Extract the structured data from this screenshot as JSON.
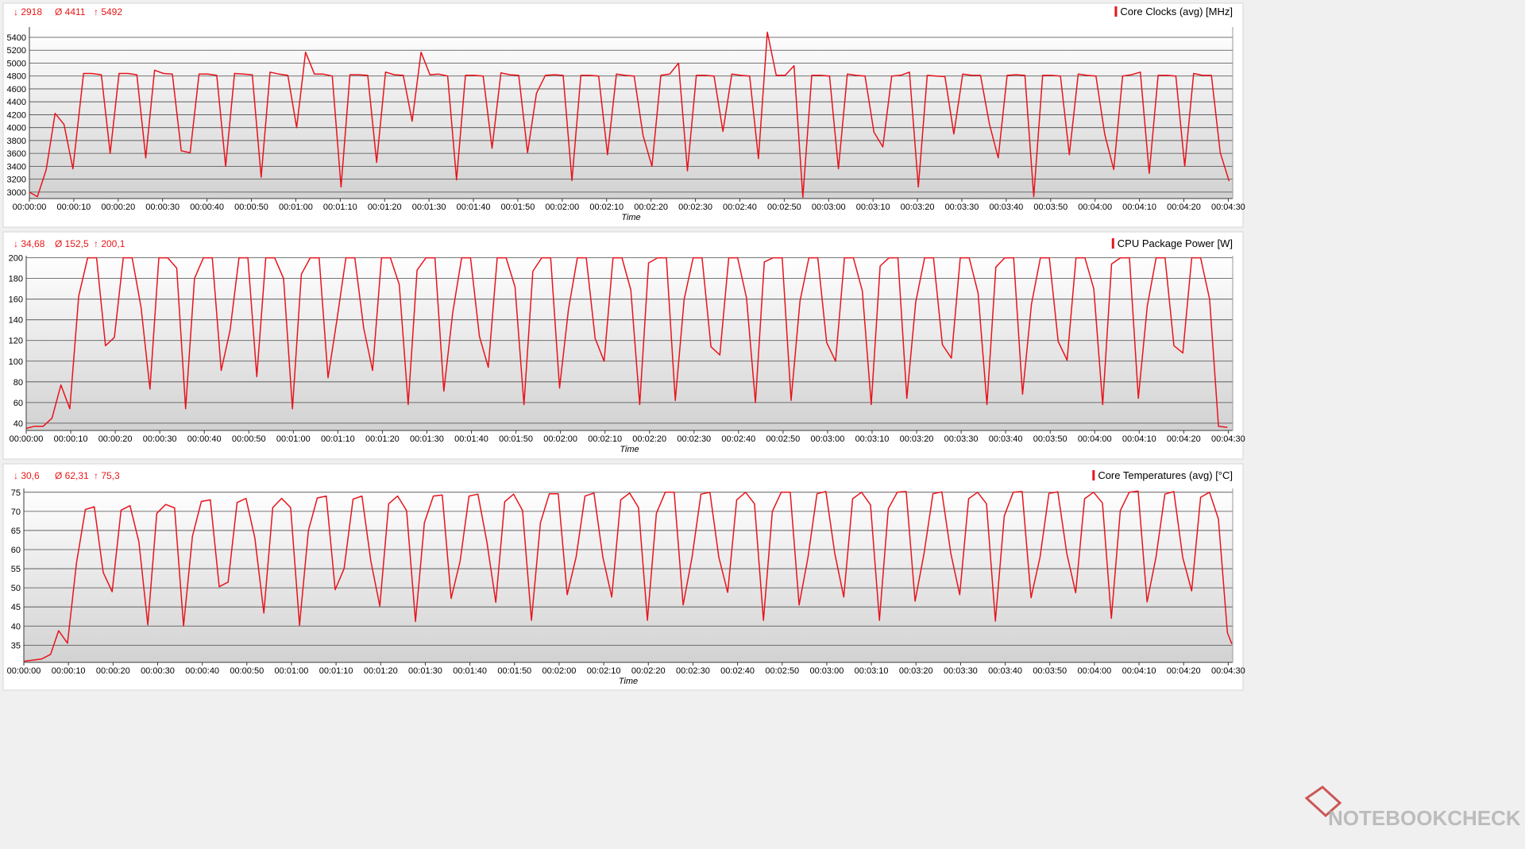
{
  "watermark": {
    "text": "NOTEBOOKCHECK"
  },
  "colors": {
    "series": "#e8141c",
    "stat_text": "#e81818",
    "grid": "#4a4a4a",
    "plot_top": "#ffffff",
    "plot_bottom": "#d2d2d2"
  },
  "chart_data": [
    {
      "type": "line",
      "name": "core-clocks",
      "legend": "Core Clocks (avg) [MHz]",
      "stats": {
        "min": "2918",
        "avg": "4411",
        "max": "5492"
      },
      "xlabel": "Time",
      "ylabel": "",
      "x_unit": "seconds",
      "xlim": [
        0,
        271
      ],
      "ylim": [
        2900,
        5560
      ],
      "y_ticks": [
        3000,
        3200,
        3400,
        3600,
        3800,
        4000,
        4200,
        4400,
        4600,
        4800,
        5000,
        5200,
        5400
      ],
      "x_ticks": [
        {
          "s": 0,
          "label": "00:00:00"
        },
        {
          "s": 10,
          "label": "00:00:10"
        },
        {
          "s": 20,
          "label": "00:00:20"
        },
        {
          "s": 30,
          "label": "00:00:30"
        },
        {
          "s": 40,
          "label": "00:00:40"
        },
        {
          "s": 50,
          "label": "00:00:50"
        },
        {
          "s": 60,
          "label": "00:01:00"
        },
        {
          "s": 70,
          "label": "00:01:10"
        },
        {
          "s": 80,
          "label": "00:01:20"
        },
        {
          "s": 90,
          "label": "00:01:30"
        },
        {
          "s": 100,
          "label": "00:01:40"
        },
        {
          "s": 110,
          "label": "00:01:50"
        },
        {
          "s": 120,
          "label": "00:02:00"
        },
        {
          "s": 130,
          "label": "00:02:10"
        },
        {
          "s": 140,
          "label": "00:02:20"
        },
        {
          "s": 150,
          "label": "00:02:30"
        },
        {
          "s": 160,
          "label": "00:02:40"
        },
        {
          "s": 170,
          "label": "00:02:50"
        },
        {
          "s": 180,
          "label": "00:03:00"
        },
        {
          "s": 190,
          "label": "00:03:10"
        },
        {
          "s": 200,
          "label": "00:03:20"
        },
        {
          "s": 210,
          "label": "00:03:30"
        },
        {
          "s": 220,
          "label": "00:03:40"
        },
        {
          "s": 230,
          "label": "00:03:50"
        },
        {
          "s": 240,
          "label": "00:04:00"
        },
        {
          "s": 250,
          "label": "00:04:10"
        },
        {
          "s": 260,
          "label": "00:04:20"
        },
        {
          "s": 270,
          "label": "00:04:30"
        }
      ],
      "x": [
        0,
        1.8,
        3.8,
        5.8,
        7.8,
        9.8,
        12.2,
        14,
        16.2,
        18.2,
        20.2,
        22.2,
        24.2,
        26.2,
        28.2,
        30.2,
        32.2,
        34.2,
        36.2,
        38.2,
        40.2,
        42.2,
        44.2,
        46.2,
        48.2,
        50.2,
        52.2,
        54.2,
        56.2,
        58.2,
        60.2,
        62.2,
        64.2,
        66.2,
        68.2,
        70.2,
        72.2,
        74.2,
        76.2,
        78.2,
        80.2,
        82.2,
        84.2,
        86.2,
        88.2,
        90.2,
        92.2,
        94.2,
        96.2,
        98.2,
        100.2,
        102.2,
        104.2,
        106.2,
        108.2,
        110.2,
        112.2,
        114.2,
        116.2,
        118.2,
        120.2,
        122.2,
        124.2,
        126.2,
        128.2,
        130.2,
        132.2,
        134.2,
        136.2,
        138.2,
        140.2,
        142.2,
        144.2,
        146.2,
        148.2,
        150.2,
        152.2,
        154.2,
        156.2,
        158.2,
        160.2,
        162.2,
        164.2,
        166.2,
        168.2,
        170.2,
        172.2,
        174.2,
        176.2,
        178.2,
        180.2,
        182.2,
        184.2,
        186.2,
        188.2,
        190.2,
        192.2,
        194.2,
        196.2,
        198.2,
        200.2,
        202.2,
        204.2,
        206.2,
        208.2,
        210.2,
        212.2,
        214.2,
        216.2,
        218.2,
        220.2,
        222.2,
        224.2,
        226.2,
        228.2,
        230.2,
        232.2,
        234.2,
        236.2,
        238.2,
        240.2,
        242.2,
        244.2,
        246.2,
        248.2,
        250.2,
        252.2,
        254.2,
        256.2,
        258.2,
        260.2,
        262.2,
        264.2,
        266.2,
        268.2,
        270.2
      ],
      "y": [
        3000,
        2930,
        3350,
        4220,
        4050,
        3360,
        4840,
        4840,
        4820,
        3600,
        4840,
        4840,
        4820,
        3530,
        4890,
        4840,
        4830,
        3640,
        3610,
        4830,
        4830,
        4810,
        3400,
        4840,
        4830,
        4820,
        3230,
        4860,
        4830,
        4810,
        4000,
        5170,
        4830,
        4830,
        4800,
        3080,
        4820,
        4820,
        4810,
        3460,
        4860,
        4820,
        4810,
        4100,
        5170,
        4820,
        4830,
        4800,
        3190,
        4810,
        4810,
        4800,
        3680,
        4850,
        4820,
        4810,
        3610,
        4530,
        4810,
        4820,
        4810,
        3180,
        4810,
        4810,
        4800,
        3580,
        4830,
        4810,
        4800,
        3880,
        3400,
        4810,
        4830,
        5000,
        3330,
        4810,
        4810,
        4800,
        3940,
        4830,
        4810,
        4800,
        3520,
        5480,
        4810,
        4810,
        4960,
        2920,
        4810,
        4810,
        4800,
        3360,
        4830,
        4810,
        4800,
        3930,
        3700,
        4800,
        4810,
        4860,
        3080,
        4810,
        4800,
        4790,
        3900,
        4830,
        4810,
        4810,
        4060,
        3530,
        4810,
        4820,
        4810,
        2930,
        4810,
        4810,
        4800,
        3580,
        4830,
        4810,
        4800,
        3890,
        3350,
        4800,
        4820,
        4860,
        3290,
        4810,
        4810,
        4800,
        3400,
        4840,
        4810,
        4810,
        3610,
        3170,
        2940
      ]
    },
    {
      "type": "line",
      "name": "cpu-package-power",
      "legend": "CPU Package Power [W]",
      "stats": {
        "min": "34,68",
        "avg": "152,5",
        "max": "200,1"
      },
      "xlabel": "Time",
      "ylabel": "",
      "x_unit": "seconds",
      "xlim": [
        0,
        271
      ],
      "ylim": [
        33,
        202
      ],
      "y_ticks": [
        40,
        60,
        80,
        100,
        120,
        140,
        160,
        180,
        200
      ],
      "x_ticks": [
        {
          "s": 0,
          "label": "00:00:00"
        },
        {
          "s": 10,
          "label": "00:00:10"
        },
        {
          "s": 20,
          "label": "00:00:20"
        },
        {
          "s": 30,
          "label": "00:00:30"
        },
        {
          "s": 40,
          "label": "00:00:40"
        },
        {
          "s": 50,
          "label": "00:00:50"
        },
        {
          "s": 60,
          "label": "00:01:00"
        },
        {
          "s": 70,
          "label": "00:01:10"
        },
        {
          "s": 80,
          "label": "00:01:20"
        },
        {
          "s": 90,
          "label": "00:01:30"
        },
        {
          "s": 100,
          "label": "00:01:40"
        },
        {
          "s": 110,
          "label": "00:01:50"
        },
        {
          "s": 120,
          "label": "00:02:00"
        },
        {
          "s": 130,
          "label": "00:02:10"
        },
        {
          "s": 140,
          "label": "00:02:20"
        },
        {
          "s": 150,
          "label": "00:02:30"
        },
        {
          "s": 160,
          "label": "00:02:40"
        },
        {
          "s": 170,
          "label": "00:02:50"
        },
        {
          "s": 180,
          "label": "00:03:00"
        },
        {
          "s": 190,
          "label": "00:03:10"
        },
        {
          "s": 200,
          "label": "00:03:20"
        },
        {
          "s": 210,
          "label": "00:03:30"
        },
        {
          "s": 220,
          "label": "00:03:40"
        },
        {
          "s": 230,
          "label": "00:03:50"
        },
        {
          "s": 240,
          "label": "00:04:00"
        },
        {
          "s": 250,
          "label": "00:04:10"
        },
        {
          "s": 260,
          "label": "00:04:20"
        },
        {
          "s": 270,
          "label": "00:04:30"
        }
      ],
      "x": [
        0,
        1.8,
        3.8,
        5.8,
        7.8,
        9.8,
        11.8,
        13.8,
        15.8,
        17.8,
        19.8,
        21.8,
        23.8,
        25.8,
        27.8,
        29.8,
        31.8,
        33.8,
        35.8,
        37.8,
        39.8,
        41.8,
        43.8,
        45.8,
        47.8,
        49.8,
        51.8,
        53.8,
        55.8,
        57.8,
        59.8,
        61.8,
        63.8,
        65.8,
        67.8,
        69.8,
        71.8,
        73.8,
        75.8,
        77.8,
        79.8,
        81.8,
        83.8,
        85.8,
        87.8,
        89.8,
        91.8,
        93.8,
        95.8,
        97.8,
        99.8,
        101.8,
        103.8,
        105.8,
        107.8,
        109.8,
        111.8,
        113.8,
        115.8,
        117.8,
        119.8,
        121.8,
        123.8,
        125.8,
        127.8,
        129.8,
        131.8,
        133.8,
        135.8,
        137.8,
        139.8,
        141.8,
        143.8,
        145.8,
        147.8,
        149.8,
        151.8,
        153.8,
        155.8,
        157.8,
        159.8,
        161.8,
        163.8,
        165.8,
        167.8,
        169.8,
        171.8,
        173.8,
        175.8,
        177.8,
        179.8,
        181.8,
        183.8,
        185.8,
        187.8,
        189.8,
        191.8,
        193.8,
        195.8,
        197.8,
        199.8,
        201.8,
        203.8,
        205.8,
        207.8,
        209.8,
        211.8,
        213.8,
        215.8,
        217.8,
        219.8,
        221.8,
        223.8,
        225.8,
        227.8,
        229.8,
        231.8,
        233.8,
        235.8,
        237.8,
        239.8,
        241.8,
        243.8,
        245.8,
        247.8,
        249.8,
        251.8,
        253.8,
        255.8,
        257.8,
        259.8,
        261.8,
        263.8,
        265.8,
        267.8,
        269.8,
        270.8
      ],
      "y": [
        35,
        37,
        37,
        45,
        77,
        54,
        163,
        200,
        200,
        115,
        123,
        200,
        200,
        152,
        73,
        200,
        200,
        190,
        54,
        180,
        200,
        200,
        91,
        130,
        200,
        200,
        85,
        200,
        200,
        180,
        54,
        184,
        200,
        200,
        84,
        140,
        200,
        200,
        132,
        91,
        200,
        200,
        174,
        58,
        188,
        200,
        200,
        71,
        147,
        200,
        200,
        124,
        94,
        200,
        200,
        172,
        58,
        187,
        200,
        200,
        74,
        150,
        200,
        200,
        122,
        100,
        200,
        200,
        169,
        58,
        195,
        200,
        200,
        62,
        160,
        200,
        200,
        114,
        106,
        200,
        200,
        161,
        60,
        196,
        200,
        200,
        62,
        158,
        200,
        200,
        118,
        100,
        200,
        200,
        168,
        58,
        192,
        200,
        200,
        64,
        157,
        200,
        200,
        116,
        103,
        200,
        200,
        166,
        58,
        191,
        200,
        200,
        68,
        155,
        200,
        200,
        119,
        101,
        200,
        200,
        170,
        58,
        194,
        200,
        200,
        64,
        153,
        200,
        200,
        115,
        108,
        200,
        200,
        160,
        37,
        36
      ]
    },
    {
      "type": "line",
      "name": "core-temperatures",
      "legend": "Core Temperatures (avg) [°C]",
      "stats": {
        "min": "30,6",
        "avg": "62,31",
        "max": "75,3"
      },
      "xlabel": "Time",
      "ylabel": "",
      "x_unit": "seconds",
      "xlim": [
        0,
        271
      ],
      "ylim": [
        30.5,
        76
      ],
      "y_ticks": [
        35,
        40,
        45,
        50,
        55,
        60,
        65,
        70,
        75
      ],
      "x_ticks": [
        {
          "s": 0,
          "label": "00:00:00"
        },
        {
          "s": 10,
          "label": "00:00:10"
        },
        {
          "s": 20,
          "label": "00:00:20"
        },
        {
          "s": 30,
          "label": "00:00:30"
        },
        {
          "s": 40,
          "label": "00:00:40"
        },
        {
          "s": 50,
          "label": "00:00:50"
        },
        {
          "s": 60,
          "label": "00:01:00"
        },
        {
          "s": 70,
          "label": "00:01:10"
        },
        {
          "s": 80,
          "label": "00:01:20"
        },
        {
          "s": 90,
          "label": "00:01:30"
        },
        {
          "s": 100,
          "label": "00:01:40"
        },
        {
          "s": 110,
          "label": "00:01:50"
        },
        {
          "s": 120,
          "label": "00:02:00"
        },
        {
          "s": 130,
          "label": "00:02:10"
        },
        {
          "s": 140,
          "label": "00:02:20"
        },
        {
          "s": 150,
          "label": "00:02:30"
        },
        {
          "s": 160,
          "label": "00:02:40"
        },
        {
          "s": 170,
          "label": "00:02:50"
        },
        {
          "s": 180,
          "label": "00:03:00"
        },
        {
          "s": 190,
          "label": "00:03:10"
        },
        {
          "s": 200,
          "label": "00:03:20"
        },
        {
          "s": 210,
          "label": "00:03:30"
        },
        {
          "s": 220,
          "label": "00:03:40"
        },
        {
          "s": 230,
          "label": "00:03:50"
        },
        {
          "s": 240,
          "label": "00:04:00"
        },
        {
          "s": 250,
          "label": "00:04:10"
        },
        {
          "s": 260,
          "label": "00:04:20"
        },
        {
          "s": 270,
          "label": "00:04:30"
        }
      ],
      "x": [
        0,
        4,
        6,
        7.8,
        9.8,
        11.8,
        13.8,
        15.8,
        17.8,
        19.8,
        21.8,
        23.8,
        25.8,
        27.8,
        29.8,
        31.8,
        33.8,
        35.8,
        37.8,
        39.8,
        41.8,
        43.8,
        45.8,
        47.8,
        49.8,
        51.8,
        53.8,
        55.8,
        57.8,
        59.8,
        61.8,
        63.8,
        65.8,
        67.8,
        69.8,
        71.8,
        73.8,
        75.8,
        77.8,
        79.8,
        81.8,
        83.8,
        85.8,
        87.8,
        89.8,
        91.8,
        93.8,
        95.8,
        97.8,
        99.8,
        101.8,
        103.8,
        105.8,
        107.8,
        109.8,
        111.8,
        113.8,
        115.8,
        117.8,
        119.8,
        121.8,
        123.8,
        125.8,
        127.8,
        129.8,
        131.8,
        133.8,
        135.8,
        137.8,
        139.8,
        141.8,
        143.8,
        145.8,
        147.8,
        149.8,
        151.8,
        153.8,
        155.8,
        157.8,
        159.8,
        161.8,
        163.8,
        165.8,
        167.8,
        169.8,
        171.8,
        173.8,
        175.8,
        177.8,
        179.8,
        181.8,
        183.8,
        185.8,
        187.8,
        189.8,
        191.8,
        193.8,
        195.8,
        197.8,
        199.8,
        201.8,
        203.8,
        205.8,
        207.8,
        209.8,
        211.8,
        213.8,
        215.8,
        217.8,
        219.8,
        221.8,
        223.8,
        225.8,
        227.8,
        229.8,
        231.8,
        233.8,
        235.8,
        237.8,
        239.8,
        241.8,
        243.8,
        245.8,
        247.8,
        249.8,
        251.8,
        253.8,
        255.8,
        257.8,
        259.8,
        261.8,
        263.8,
        265.8,
        267.8,
        269.8,
        270.8
      ],
      "y": [
        30.8,
        31.4,
        32.6,
        38.8,
        35.5,
        56.5,
        70.5,
        71.2,
        54,
        49,
        70.3,
        71.5,
        62,
        40.3,
        69.5,
        71.8,
        70.9,
        40,
        63.5,
        72.6,
        73,
        50.3,
        51.5,
        72.3,
        73.4,
        63,
        43.4,
        71,
        73.4,
        71,
        40.2,
        65,
        73.5,
        74,
        49.5,
        55,
        73.2,
        74,
        57,
        45.2,
        72,
        74,
        70.2,
        41.2,
        67,
        74,
        74.3,
        47.2,
        57,
        74,
        74.5,
        62,
        46.2,
        72.5,
        74.5,
        70.2,
        41.5,
        67,
        74.6,
        74.6,
        48.2,
        58,
        74,
        74.8,
        58,
        47.6,
        73,
        74.8,
        71,
        41.5,
        69.5,
        75,
        75,
        45.5,
        58,
        74.5,
        75,
        58,
        48.8,
        73,
        75,
        72,
        41.5,
        70,
        75,
        75,
        45.5,
        58,
        74.6,
        75.2,
        59,
        47.6,
        73.3,
        75,
        71.7,
        41.5,
        70.7,
        75,
        75.2,
        46.5,
        59,
        74.6,
        75.1,
        59,
        48.2,
        73.3,
        75,
        72,
        41.3,
        68.8,
        75,
        75.2,
        47.4,
        58,
        74.7,
        75.1,
        59,
        48.7,
        73.3,
        75,
        72.2,
        42,
        70.2,
        75,
        75.3,
        46.3,
        58,
        74.5,
        75.2,
        57.9,
        49.2,
        73.7,
        75,
        68,
        38.3,
        35.3
      ]
    }
  ]
}
